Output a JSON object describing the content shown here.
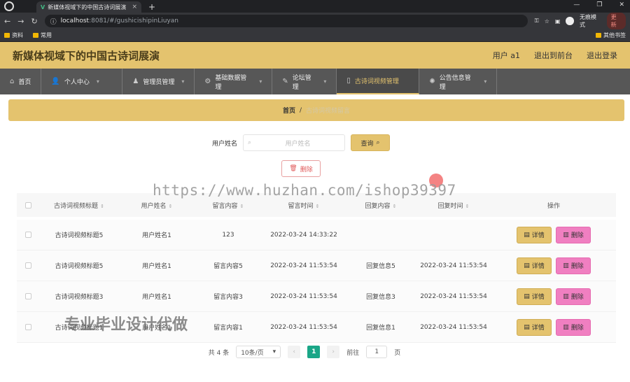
{
  "browser": {
    "tab_title": "新媒体视域下的中国古诗词展演",
    "close": "×",
    "new_tab": "+",
    "url_host": "localhost",
    "url_path": ":8081/#/gushicishipinLiuyan",
    "profile": "无痕模式",
    "update": "更新",
    "bookmarks": [
      "资料",
      "常用"
    ],
    "bookmark_right": "其他书签",
    "window_controls": [
      "—",
      "❐",
      "✕"
    ]
  },
  "header": {
    "title": "新媒体视域下的中国古诗词展演",
    "user": "用户 a1",
    "back": "退出到前台",
    "logout": "退出登录"
  },
  "nav": {
    "items": [
      {
        "label": "首页"
      },
      {
        "label": "个人中心"
      },
      {
        "label": "管理员管理"
      },
      {
        "label": "基础数据管理"
      },
      {
        "label": "论坛管理"
      },
      {
        "label": "古诗词视频管理"
      },
      {
        "label": "公告信息管理"
      }
    ]
  },
  "breadcrumb": {
    "home": "首页",
    "sep": "/",
    "current": "古诗词视频留言"
  },
  "search": {
    "label": "用户姓名",
    "placeholder": "用户姓名",
    "button": "查询"
  },
  "actions": {
    "delete": "删除"
  },
  "watermarks": {
    "url": "https://www.huzhan.com/ishop39397",
    "text": "专业毕业设计代做"
  },
  "table": {
    "headers": [
      "古诗词视频标题",
      "用户姓名",
      "留言内容",
      "留言时间",
      "回复内容",
      "回复时间",
      "操作"
    ],
    "rows": [
      {
        "title": "古诗词视频标题5",
        "user": "用户姓名1",
        "content": "123",
        "time": "2022-03-24 14:33:22",
        "reply": "",
        "reply_time": ""
      },
      {
        "title": "古诗词视频标题5",
        "user": "用户姓名1",
        "content": "留言内容5",
        "time": "2022-03-24 11:53:54",
        "reply": "回复信息5",
        "reply_time": "2022-03-24 11:53:54"
      },
      {
        "title": "古诗词视频标题3",
        "user": "用户姓名1",
        "content": "留言内容3",
        "time": "2022-03-24 11:53:54",
        "reply": "回复信息3",
        "reply_time": "2022-03-24 11:53:54"
      },
      {
        "title": "古诗词视频标题1",
        "user": "用户姓名1",
        "content": "留言内容1",
        "time": "2022-03-24 11:53:54",
        "reply": "回复信息1",
        "reply_time": "2022-03-24 11:53:54"
      }
    ],
    "detail_label": "详情",
    "delete_label": "删除"
  },
  "pager": {
    "total": "共 4 条",
    "page_size": "10条/页",
    "current": "1",
    "goto_prefix": "前往",
    "goto_value": "1",
    "goto_suffix": "页"
  }
}
